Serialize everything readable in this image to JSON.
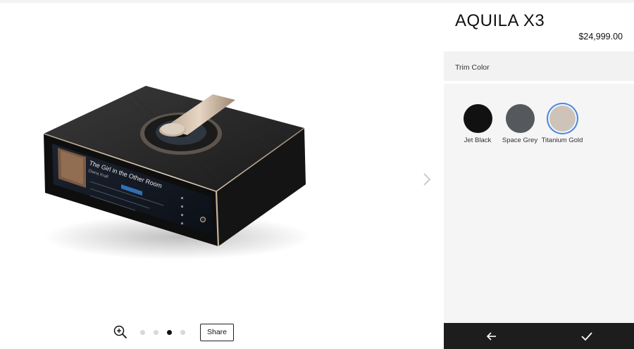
{
  "product": {
    "name": "AQUILA X3",
    "price": "$24,999.00"
  },
  "options": {
    "label": "Trim Color",
    "swatches": [
      {
        "name": "Jet Black",
        "color": "#111111",
        "selected": false
      },
      {
        "name": "Space Grey",
        "color": "#55585d",
        "selected": false
      },
      {
        "name": "Titanium Gold",
        "color": "#cdc3b8",
        "selected": true
      }
    ]
  },
  "device_screen": {
    "track_title": "The Girl in the Other Room",
    "artist": "Diana Krall"
  },
  "gallery": {
    "share_label": "Share",
    "slides": 4,
    "active_slide": 3
  },
  "colors": {
    "accent": "#4a86e8",
    "footer": "#1d1d1d",
    "panel": "#f5f5f5"
  },
  "icons": {
    "zoom": "zoom-in-icon",
    "next": "chevron-right-icon",
    "back": "arrow-left-icon",
    "confirm": "check-icon"
  }
}
